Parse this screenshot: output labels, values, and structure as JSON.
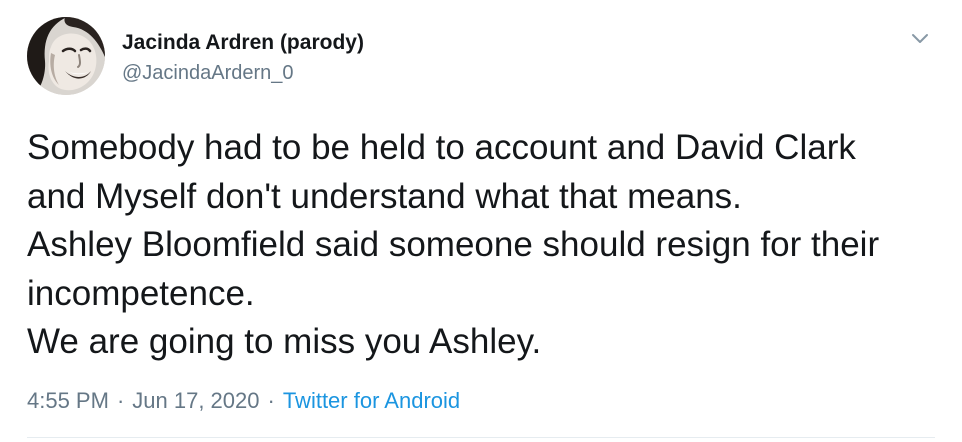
{
  "tweet": {
    "author": {
      "name": "Jacinda Ardren (parody)",
      "handle": "@JacindaArdern_0"
    },
    "text_lines": [
      "Somebody had to be held to account and David Clark",
      "and Myself don't understand what that means.",
      "Ashley Bloomfield said someone should resign for their",
      "incompetence.",
      "We are going to miss you Ashley."
    ],
    "meta": {
      "time": "4:55 PM",
      "separator": "·",
      "date": "Jun 17, 2020",
      "source": "Twitter for Android"
    },
    "icons": {
      "more": "chevron-down-icon"
    },
    "colors": {
      "text": "#14171a",
      "secondary": "#657786",
      "link": "#1b95e0",
      "divider": "#e6ecf0"
    }
  }
}
